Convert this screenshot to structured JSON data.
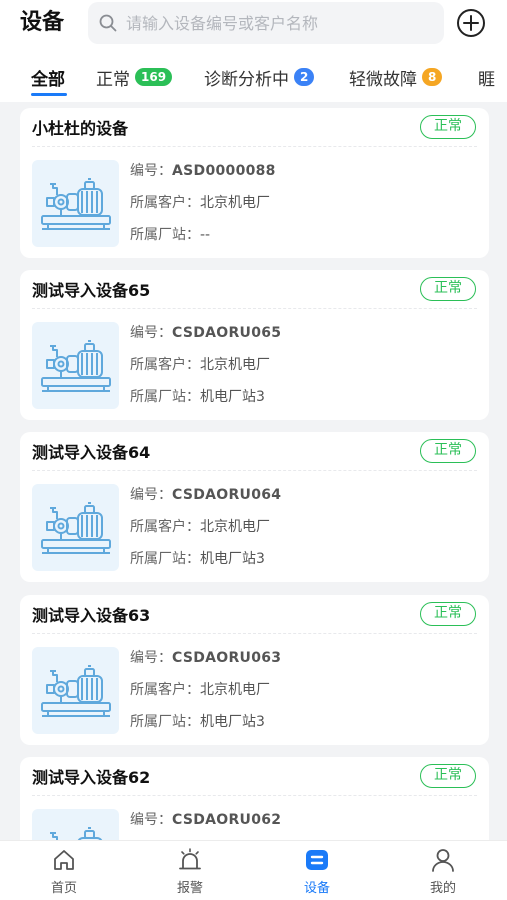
{
  "header": {
    "title": "设备",
    "search_placeholder": "请输入设备编号或客户名称",
    "search_value": ""
  },
  "tabs": [
    {
      "label": "全部",
      "badge": "",
      "active": true
    },
    {
      "label": "正常",
      "badge": "169",
      "badge_color": "#2bbf57"
    },
    {
      "label": "诊断分析中",
      "badge": "2",
      "badge_color": "#3b82f6"
    },
    {
      "label": "轻微故障",
      "badge": "8",
      "badge_color": "#f5a623"
    },
    {
      "label": "睚",
      "badge": ""
    }
  ],
  "devices": [
    {
      "name": "小杜杜的设备",
      "status": "正常",
      "code_label": "编号：",
      "code": "ASD0000088",
      "customer_label": "所属客户：",
      "customer": "北京机电厂",
      "station_label": "所属厂站：",
      "station": "--"
    },
    {
      "name": "测试导入设备65",
      "status": "正常",
      "code_label": "编号：",
      "code": "CSDAORU065",
      "customer_label": "所属客户：",
      "customer": "北京机电厂",
      "station_label": "所属厂站：",
      "station": "机电厂站3"
    },
    {
      "name": "测试导入设备64",
      "status": "正常",
      "code_label": "编号：",
      "code": "CSDAORU064",
      "customer_label": "所属客户：",
      "customer": "北京机电厂",
      "station_label": "所属厂站：",
      "station": "机电厂站3"
    },
    {
      "name": "测试导入设备63",
      "status": "正常",
      "code_label": "编号：",
      "code": "CSDAORU063",
      "customer_label": "所属客户：",
      "customer": "北京机电厂",
      "station_label": "所属厂站：",
      "station": "机电厂站3"
    },
    {
      "name": "测试导入设备62",
      "status": "正常",
      "code_label": "编号：",
      "code": "CSDAORU062",
      "customer_label": "所属客户：",
      "customer": "",
      "station_label": "",
      "station": ""
    }
  ],
  "nav": [
    {
      "label": "首页",
      "icon": "home-icon"
    },
    {
      "label": "报警",
      "icon": "alarm-icon"
    },
    {
      "label": "设备",
      "icon": "device-icon",
      "active": true
    },
    {
      "label": "我的",
      "icon": "user-icon"
    }
  ],
  "colors": {
    "accent": "#1a7af8",
    "status_ok": "#2bbf57",
    "thumb_bg": "#eaf4fc"
  }
}
